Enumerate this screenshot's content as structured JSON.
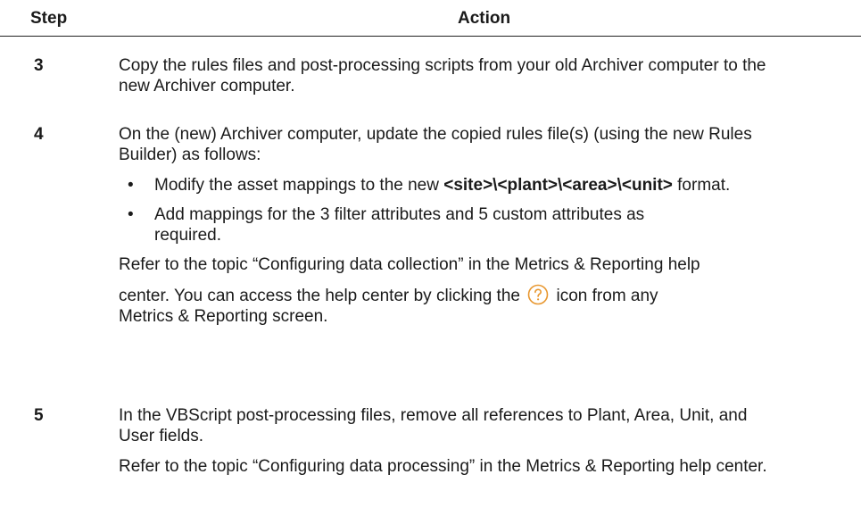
{
  "header": {
    "step_label": "Step",
    "action_label": "Action"
  },
  "steps": [
    {
      "number": "3",
      "text": "Copy the rules files and post-processing scripts from your old Archiver computer to the new Archiver computer."
    },
    {
      "number": "4",
      "intro": "On the (new) Archiver computer, update the copied rules file(s) (using the new Rules Builder) as follows:",
      "bullets": [
        {
          "before": "Modify the asset mappings to the new ",
          "bold": "<site>\\<plant>\\<area>\\<unit>",
          "after": " format."
        },
        {
          "text": "Add mappings for the 3 filter attributes and 5 custom attributes as required."
        }
      ],
      "refer_line": "Refer to the topic “Configuring data collection” in the Metrics & Reporting help",
      "help_before": "center. You can access the help center by clicking the ",
      "help_after": " icon from any",
      "help_last": "Metrics & Reporting screen.",
      "icon": "help-question-icon",
      "icon_color": "#e8972f"
    },
    {
      "number": "5",
      "text": "In the VBScript post-processing files, remove all references to Plant, Area, Unit, and User fields.",
      "refer": "Refer to the topic “Configuring data processing” in the Metrics & Reporting help center."
    }
  ]
}
